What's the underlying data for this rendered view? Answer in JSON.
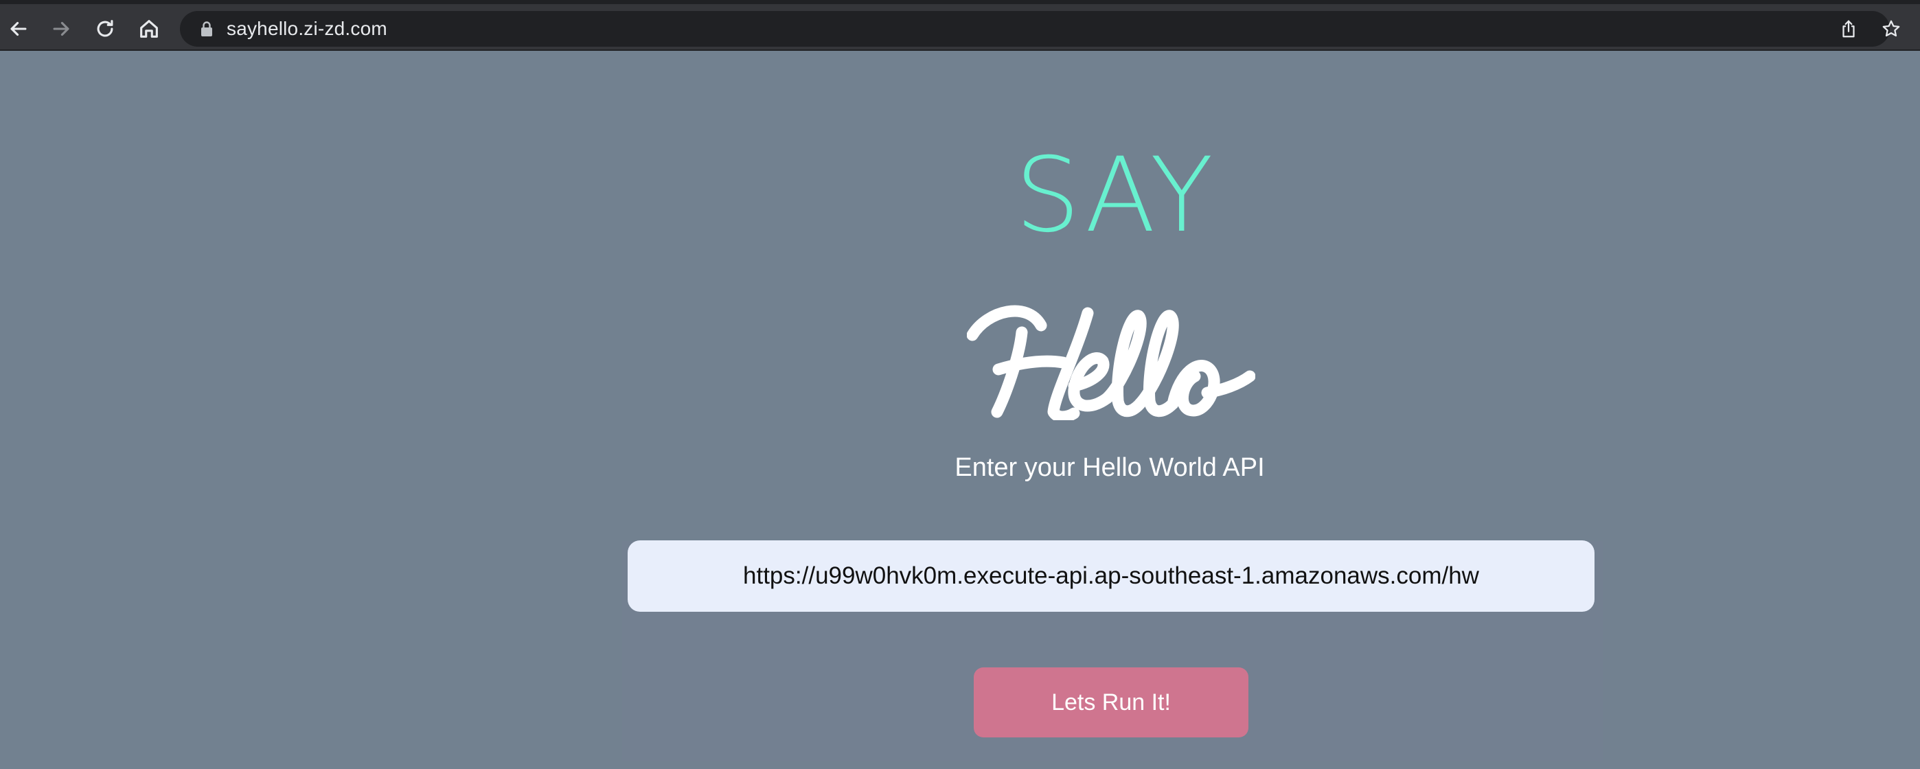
{
  "browser": {
    "url": "sayhello.zi-zd.com",
    "icons": {
      "back": "back-arrow-icon",
      "forward": "forward-arrow-icon",
      "reload": "reload-icon",
      "home": "home-icon",
      "lock": "lock-icon",
      "share": "share-icon",
      "bookmark": "star-icon"
    }
  },
  "logo": {
    "say": "SAY",
    "hello": "Hello"
  },
  "form": {
    "prompt": "Enter your Hello World API",
    "api_url": "https://u99w0hvk0m.execute-api.ap-southeast-1.amazonaws.com/hw",
    "run_label": "Lets Run It!"
  },
  "colors": {
    "background": "#728190",
    "say_accent": "#68f0cf",
    "button": "#cf758f",
    "input_bg": "#e8eefb"
  }
}
